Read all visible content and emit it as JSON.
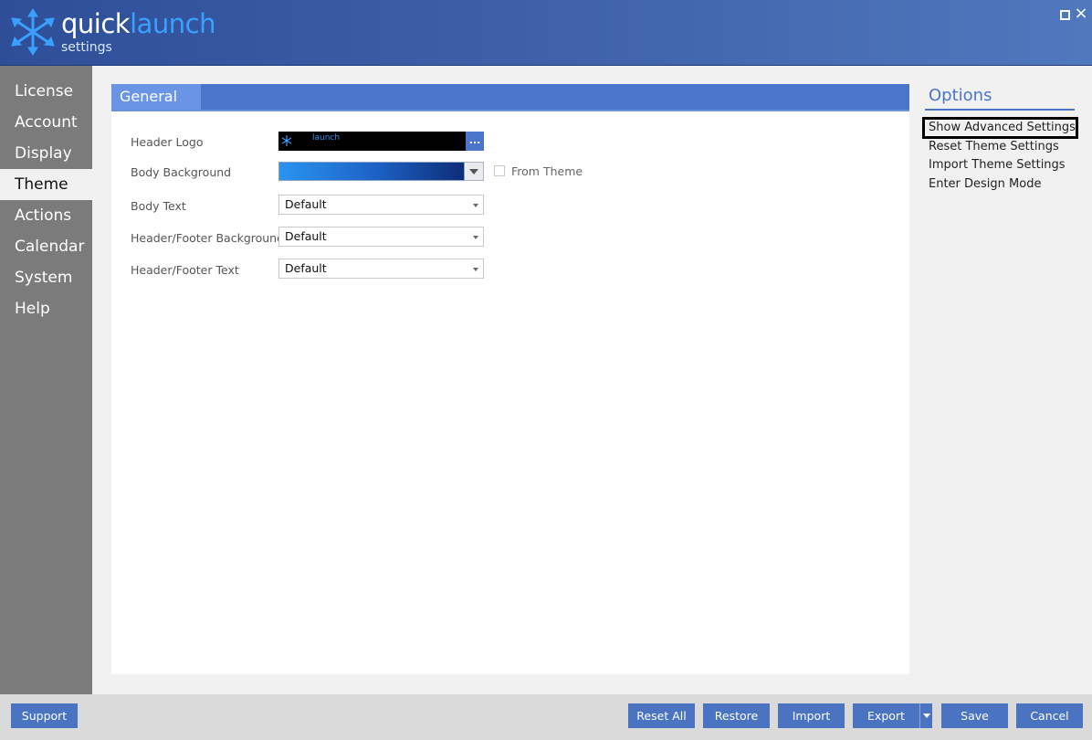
{
  "app": {
    "logo_word_quick": "quick",
    "logo_word_launch": "launch",
    "logo_subtitle": "settings",
    "window_close": "×"
  },
  "sidebar": {
    "items": [
      {
        "label": "License"
      },
      {
        "label": "Account"
      },
      {
        "label": "Display"
      },
      {
        "label": "Theme",
        "active": true
      },
      {
        "label": "Actions"
      },
      {
        "label": "Calendar"
      },
      {
        "label": "System"
      },
      {
        "label": "Help"
      }
    ]
  },
  "section": {
    "title": "General"
  },
  "form": {
    "header_logo": {
      "label": "Header Logo",
      "preview_text": "launch",
      "browse_label": "..."
    },
    "body_background": {
      "label": "Body Background",
      "from_theme_label": "From Theme",
      "from_theme_checked": false
    },
    "body_text": {
      "label": "Body Text",
      "value": "Default"
    },
    "header_footer_background": {
      "label": "Header/Footer Background",
      "value": "Default"
    },
    "header_footer_text": {
      "label": "Header/Footer Text",
      "value": "Default"
    }
  },
  "options": {
    "title": "Options",
    "items": [
      {
        "label": "Show Advanced Settings",
        "highlighted": true
      },
      {
        "label": "Reset Theme Settings"
      },
      {
        "label": "Import Theme Settings"
      },
      {
        "label": "Enter Design Mode"
      }
    ]
  },
  "footer": {
    "support": "Support",
    "reset_all": "Reset All",
    "restore": "Restore",
    "import": "Import",
    "export": "Export",
    "save": "Save",
    "cancel": "Cancel"
  },
  "colors": {
    "accent": "#4b74cb",
    "header_start": "#2e4f98",
    "header_end": "#5078bd",
    "sidebar_bg": "#7b7b7b",
    "launch_blue": "#3aa0ff",
    "gradient_start": "#2a94f0",
    "gradient_end": "#0e2d77"
  },
  "icons": {
    "logo": "quicklaunch-arrows-icon",
    "maximize": "maximize-icon",
    "close": "close-icon",
    "dropdown": "chevron-down-icon"
  }
}
